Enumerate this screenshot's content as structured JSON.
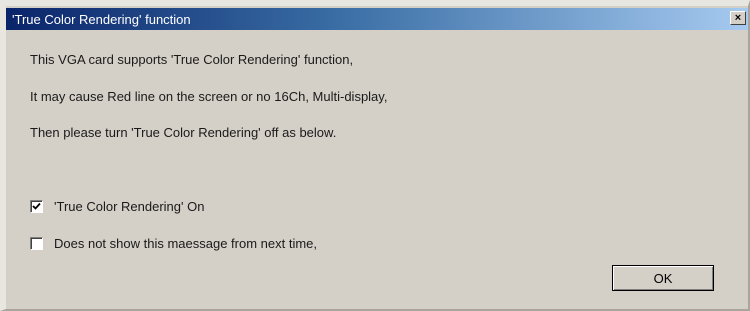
{
  "window": {
    "title": "'True Color Rendering' function",
    "close_glyph": "×"
  },
  "message": {
    "line1": "This VGA card supports 'True Color Rendering' function,",
    "line2": "It may cause Red line on the screen or no 16Ch, Multi-display,",
    "line3": "Then please turn 'True Color Rendering' off as below."
  },
  "options": [
    {
      "label": "'True Color Rendering' On",
      "checked": true
    },
    {
      "label": "Does not show this maessage from next time,",
      "checked": false
    }
  ],
  "buttons": {
    "ok_label": "OK"
  },
  "colors": {
    "face": "#d4d0c8",
    "title_start": "#0a246a",
    "title_end": "#a6caf0"
  }
}
